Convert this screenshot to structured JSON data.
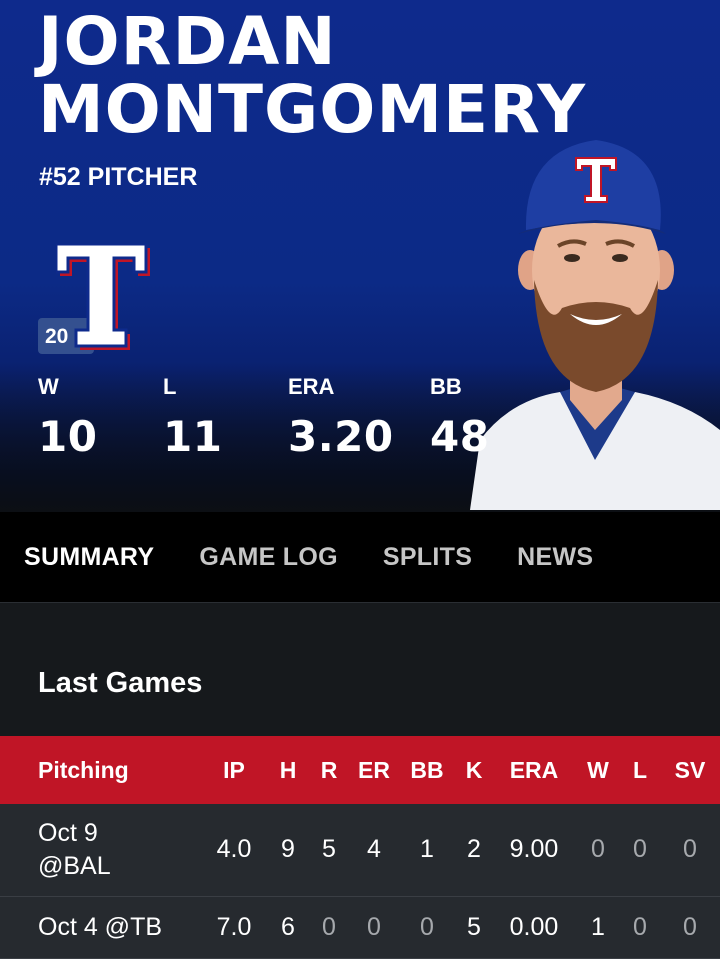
{
  "player": {
    "first_name": "JORDAN",
    "last_name": "MONTGOMERY",
    "subtitle": "#52 PITCHER",
    "season_badge": "20"
  },
  "summary_stats": [
    {
      "label": "W",
      "value": "10"
    },
    {
      "label": "L",
      "value": "11"
    },
    {
      "label": "ERA",
      "value": "3.20"
    },
    {
      "label": "BB",
      "value": "48"
    }
  ],
  "tabs": [
    "SUMMARY",
    "GAME LOG",
    "SPLITS",
    "NEWS"
  ],
  "active_tab": "SUMMARY",
  "section_title": "Last Games",
  "table": {
    "headers": [
      "Pitching",
      "IP",
      "H",
      "R",
      "ER",
      "BB",
      "K",
      "ERA",
      "W",
      "L",
      "SV"
    ],
    "rows": [
      {
        "game": "Oct 9 @BAL",
        "game_line1": "Oct 9",
        "game_line2": "@BAL",
        "cells": [
          "4.0",
          "9",
          "5",
          "4",
          "1",
          "2",
          "9.00",
          "0",
          "0",
          "0"
        ]
      },
      {
        "game": "Oct 4 @TB",
        "cells": [
          "7.0",
          "6",
          "0",
          "0",
          "0",
          "5",
          "0.00",
          "1",
          "0",
          "0"
        ]
      }
    ]
  },
  "colors": {
    "team_blue": "#0e2a8c",
    "team_red": "#c01526",
    "background": "#16191c"
  },
  "icons": {
    "team_logo": "texas-rangers-t-logo-icon"
  }
}
